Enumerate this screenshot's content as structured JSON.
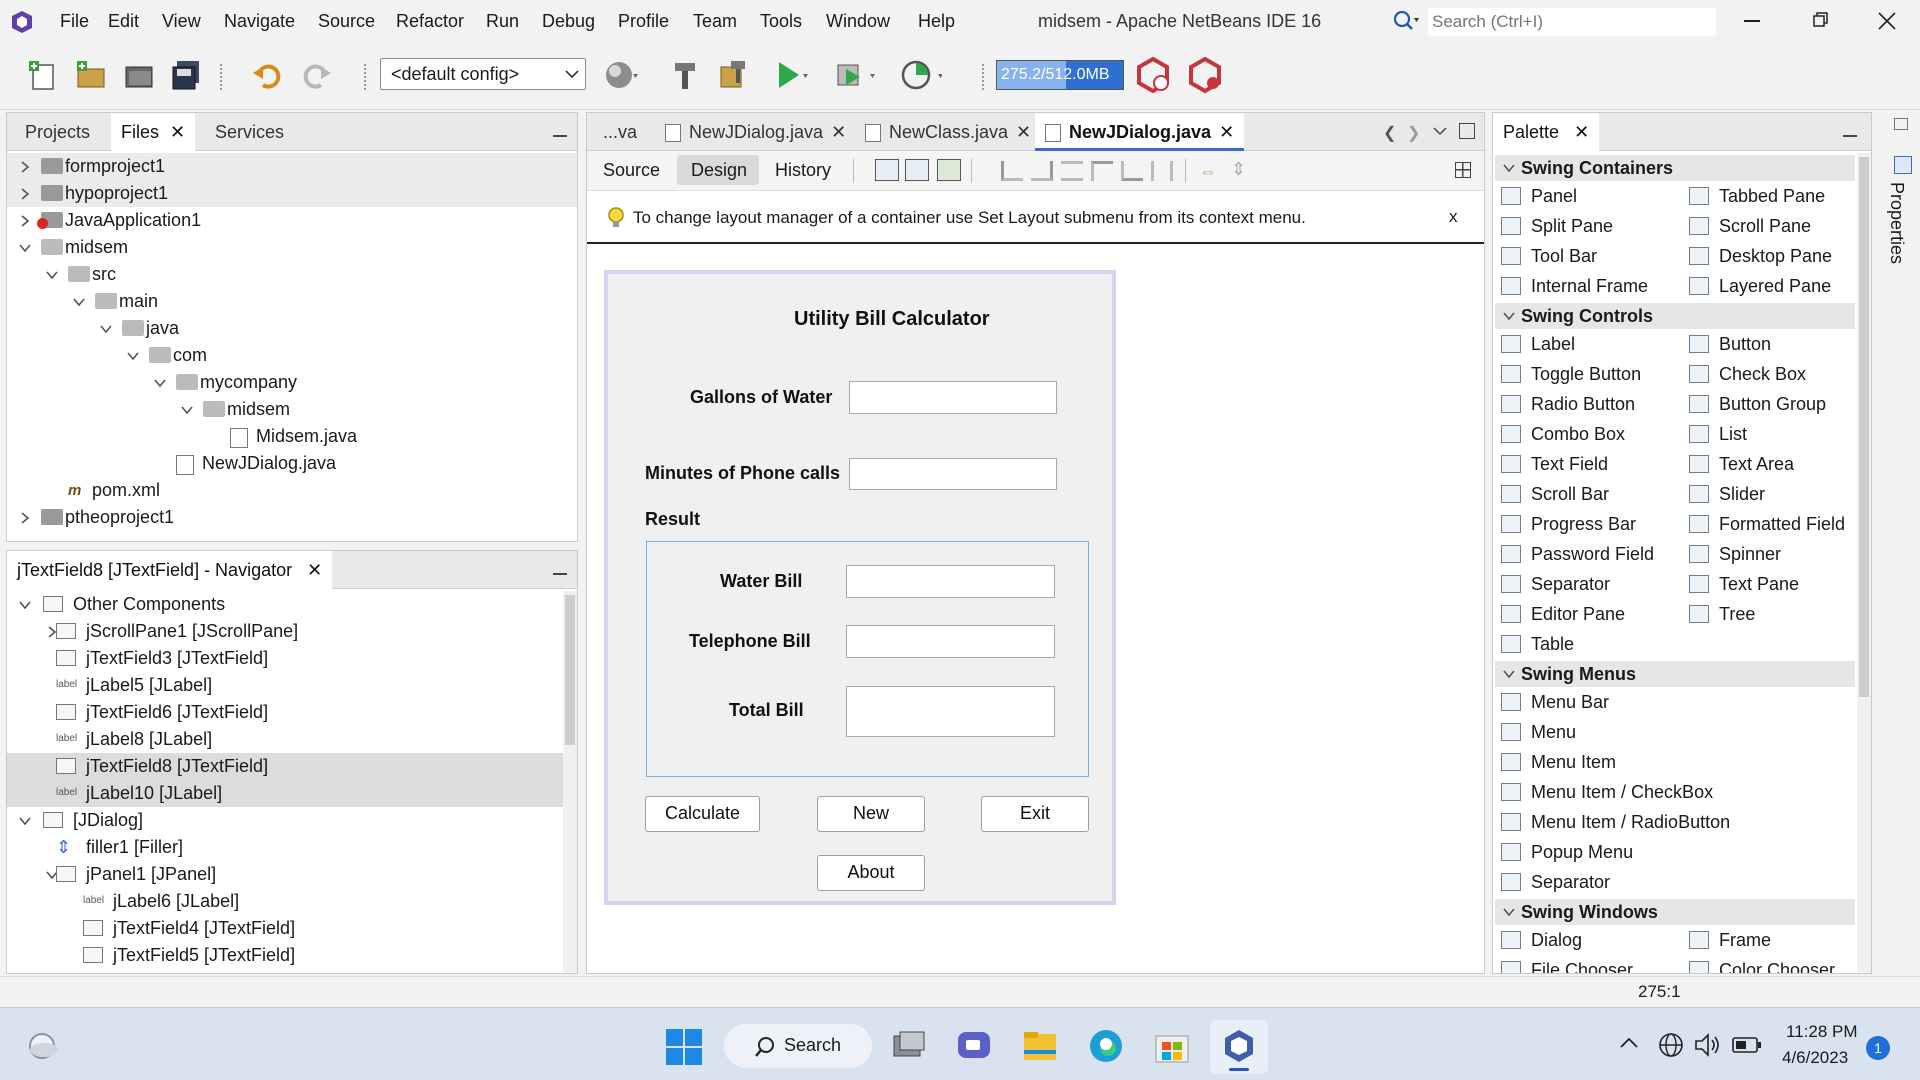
{
  "titlebar": {
    "menus": [
      "File",
      "Edit",
      "View",
      "Navigate",
      "Source",
      "Refactor",
      "Run",
      "Debug",
      "Profile",
      "Team",
      "Tools",
      "Window",
      "Help"
    ],
    "title": "midsem - Apache NetBeans IDE 16",
    "search_placeholder": "Search (Ctrl+I)"
  },
  "toolbar": {
    "config": "<default config>",
    "memory": "275.2/512.0MB"
  },
  "projects_panel": {
    "tabs": [
      "Projects",
      "Files",
      "Services"
    ],
    "active_tab": "Files",
    "tree": [
      {
        "label": "formproject1",
        "type": "folder",
        "level": 0,
        "expanded": false
      },
      {
        "label": "hypoproject1",
        "type": "folder",
        "level": 0,
        "expanded": false
      },
      {
        "label": "JavaApplication1",
        "type": "folder-error",
        "level": 0,
        "expanded": false
      },
      {
        "label": "midsem",
        "type": "folder",
        "level": 0,
        "expanded": true
      },
      {
        "label": "src",
        "type": "folder",
        "level": 1,
        "expanded": true
      },
      {
        "label": "main",
        "type": "folder",
        "level": 2,
        "expanded": true
      },
      {
        "label": "java",
        "type": "folder",
        "level": 3,
        "expanded": true
      },
      {
        "label": "com",
        "type": "folder",
        "level": 4,
        "expanded": true
      },
      {
        "label": "mycompany",
        "type": "folder",
        "level": 5,
        "expanded": true
      },
      {
        "label": "midsem",
        "type": "folder",
        "level": 6,
        "expanded": true
      },
      {
        "label": "Midsem.java",
        "type": "java",
        "level": 7
      },
      {
        "label": "NewJDialog.java",
        "type": "java",
        "level": 5
      },
      {
        "label": "pom.xml",
        "type": "xml",
        "level": 1
      },
      {
        "label": "ptheoproject1",
        "type": "folder",
        "level": 0,
        "expanded": false
      }
    ]
  },
  "navigator": {
    "title": "jTextField8 [JTextField] - Navigator",
    "items": [
      {
        "label": "Other Components",
        "level": 0,
        "expanded": true,
        "icon": "components"
      },
      {
        "label": "jScrollPane1 [JScrollPane]",
        "level": 1,
        "expandable": true,
        "icon": "scroll"
      },
      {
        "label": "jTextField3 [JTextField]",
        "level": 1,
        "icon": "textfield"
      },
      {
        "label": "jLabel5 [JLabel]",
        "level": 1,
        "icon": "label"
      },
      {
        "label": "jTextField6 [JTextField]",
        "level": 1,
        "icon": "textfield"
      },
      {
        "label": "jLabel8 [JLabel]",
        "level": 1,
        "icon": "label"
      },
      {
        "label": "jTextField8 [JTextField]",
        "level": 1,
        "icon": "textfield",
        "selected": true
      },
      {
        "label": "jLabel10 [JLabel]",
        "level": 1,
        "icon": "label",
        "selected": true
      },
      {
        "label": "[JDialog]",
        "level": 0,
        "expanded": true,
        "icon": "dialog"
      },
      {
        "label": "filler1 [Filler]",
        "level": 1,
        "icon": "filler"
      },
      {
        "label": "jPanel1 [JPanel]",
        "level": 1,
        "expanded": true,
        "icon": "panel"
      },
      {
        "label": "jLabel6 [JLabel]",
        "level": 2,
        "icon": "label"
      },
      {
        "label": "jTextField4 [JTextField]",
        "level": 2,
        "icon": "textfield"
      },
      {
        "label": "jTextField5 [JTextField]",
        "level": 2,
        "icon": "textfield"
      }
    ]
  },
  "editor": {
    "tabs": [
      "...va",
      "NewJDialog.java",
      "NewClass.java",
      "NewJDialog.java"
    ],
    "active_tab_index": 3,
    "view_tabs": [
      "Source",
      "Design",
      "History"
    ],
    "active_view": "Design",
    "hint": "To change layout manager of a container use Set Layout submenu from its context menu.",
    "hint_close": "x"
  },
  "form": {
    "title": "Utility Bill Calculator",
    "gallons_label": "Gallons of Water",
    "minutes_label": "Minutes of Phone calls",
    "result_label": "Result",
    "water_bill_label": "Water Bill",
    "telephone_bill_label": "Telephone Bill",
    "total_bill_label": "Total Bill",
    "calculate": "Calculate",
    "new": "New",
    "exit": "Exit",
    "about": "About"
  },
  "palette": {
    "title": "Palette",
    "categories": [
      {
        "name": "Swing Containers",
        "items": [
          [
            "Panel",
            "Tabbed Pane"
          ],
          [
            "Split Pane",
            "Scroll Pane"
          ],
          [
            "Tool Bar",
            "Desktop Pane"
          ],
          [
            "Internal Frame",
            "Layered Pane"
          ]
        ]
      },
      {
        "name": "Swing Controls",
        "items": [
          [
            "Label",
            "Button"
          ],
          [
            "Toggle Button",
            "Check Box"
          ],
          [
            "Radio Button",
            "Button Group"
          ],
          [
            "Combo Box",
            "List"
          ],
          [
            "Text Field",
            "Text Area"
          ],
          [
            "Scroll Bar",
            "Slider"
          ],
          [
            "Progress Bar",
            "Formatted Field"
          ],
          [
            "Password Field",
            "Spinner"
          ],
          [
            "Separator",
            "Text Pane"
          ],
          [
            "Editor Pane",
            "Tree"
          ],
          [
            "Table",
            ""
          ]
        ]
      },
      {
        "name": "Swing Menus",
        "items": [
          [
            "Menu Bar",
            ""
          ],
          [
            "Menu",
            ""
          ],
          [
            "Menu Item",
            ""
          ],
          [
            "Menu Item / CheckBox",
            ""
          ],
          [
            "Menu Item / RadioButton",
            ""
          ],
          [
            "Popup Menu",
            ""
          ],
          [
            "Separator",
            ""
          ]
        ]
      },
      {
        "name": "Swing Windows",
        "items": [
          [
            "Dialog",
            "Frame"
          ],
          [
            "File Chooser",
            "Color Chooser"
          ]
        ]
      }
    ]
  },
  "side_label": "Properties",
  "statusbar": {
    "position": "275:1"
  },
  "taskbar": {
    "search": "Search",
    "time": "11:28 PM",
    "date": "4/6/2023",
    "notifications": "1"
  },
  "colors": {
    "accent": "#3d6bc6",
    "memory_bg": "#2f6fd1",
    "selected_row": "#dcdcdc"
  }
}
